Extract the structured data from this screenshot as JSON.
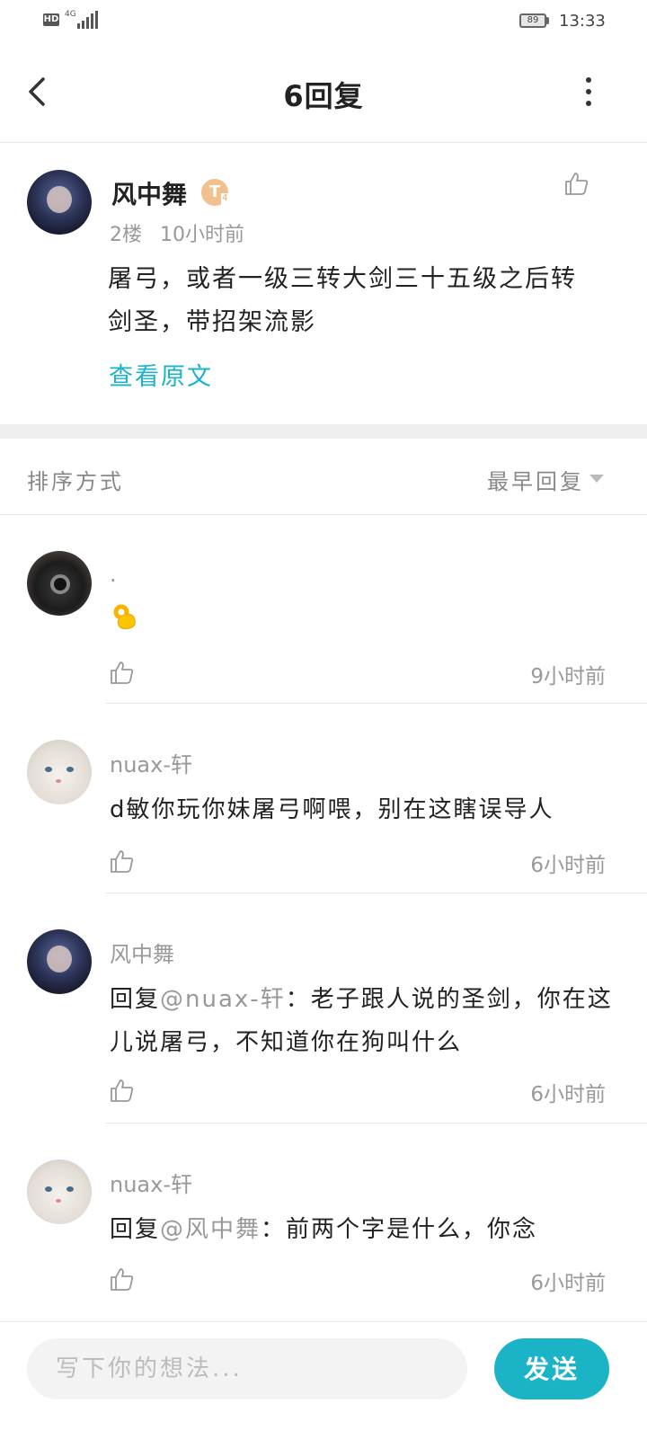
{
  "status_bar": {
    "hd": "HD",
    "network": "4G",
    "battery": "89",
    "time": "13:33"
  },
  "header": {
    "title": "6回复",
    "back_icon": "chevron-left-icon",
    "more_icon": "more-vertical-icon"
  },
  "post": {
    "author": "风中舞",
    "level_badge": "T",
    "level_number": "4",
    "floor": "2楼",
    "time": "10小时前",
    "content": "屠弓，或者一级三转大剑三十五级之后转剑圣，带招架流影",
    "view_original": "查看原文",
    "like_icon": "thumbs-up-icon"
  },
  "sort": {
    "label": "排序方式",
    "value": "最早回复",
    "caret_icon": "caret-down-icon"
  },
  "replies": [
    {
      "name": ".",
      "text": "",
      "emoji": "ok-hand-emoji",
      "time": "9小时前"
    },
    {
      "name": "nuax-轩",
      "text": "d敏你玩你妹屠弓啊喂，别在这瞎误导人",
      "time": "6小时前"
    },
    {
      "name": "风中舞",
      "prefix": "回复",
      "mention": "@nuax-轩",
      "text": "：老子跟人说的圣剑，你在这儿说屠弓，不知道你在狗叫什么",
      "time": "6小时前"
    },
    {
      "name": "nuax-轩",
      "prefix": "回复",
      "mention": "@风中舞",
      "text": "：前两个字是什么，你念",
      "time": "6小时前"
    }
  ],
  "composer": {
    "placeholder": "写下你的想法...",
    "send": "发送"
  },
  "colors": {
    "accent": "#1bb4c6",
    "text": "#222222",
    "muted": "#999999"
  }
}
